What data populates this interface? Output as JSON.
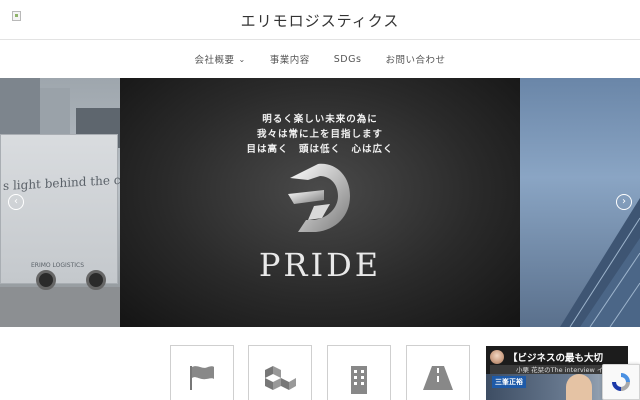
{
  "header": {
    "site_title": "エリモロジスティクス",
    "logo_icon": "broken-image-icon"
  },
  "nav": {
    "items": [
      {
        "label": "会社概要",
        "has_dropdown": true
      },
      {
        "label": "事業内容",
        "has_dropdown": false
      },
      {
        "label": "SDGs",
        "has_dropdown": false
      },
      {
        "label": "お問い合わせ",
        "has_dropdown": false
      }
    ],
    "dropdown_glyph": "⌄"
  },
  "slider": {
    "tagline": [
      "明るく楽しい未来の為に",
      "我々は常に上を目指します",
      "目は高く　頭は低く　心は広く"
    ],
    "brand_word": "PRIDE",
    "left_truck_text": "s light behind the clouds.",
    "left_truck_logo": "ERIMO LOGISTICS",
    "prev_arrow": "‹",
    "next_arrow": "›",
    "colors": {
      "dark_bg": "#2a2a2a",
      "text": "#f2f2f2"
    }
  },
  "cards": [
    {
      "icon": "flag-icon"
    },
    {
      "icon": "boxes-icon"
    },
    {
      "icon": "building-icon"
    },
    {
      "icon": "road-icon"
    }
  ],
  "video": {
    "title": "【ビジネスの最も大切",
    "subtitle": "小栗 花栞のThe interview インタ",
    "name_badge": "三峯正裕"
  },
  "recaptcha": {
    "icon": "recaptcha-icon"
  }
}
